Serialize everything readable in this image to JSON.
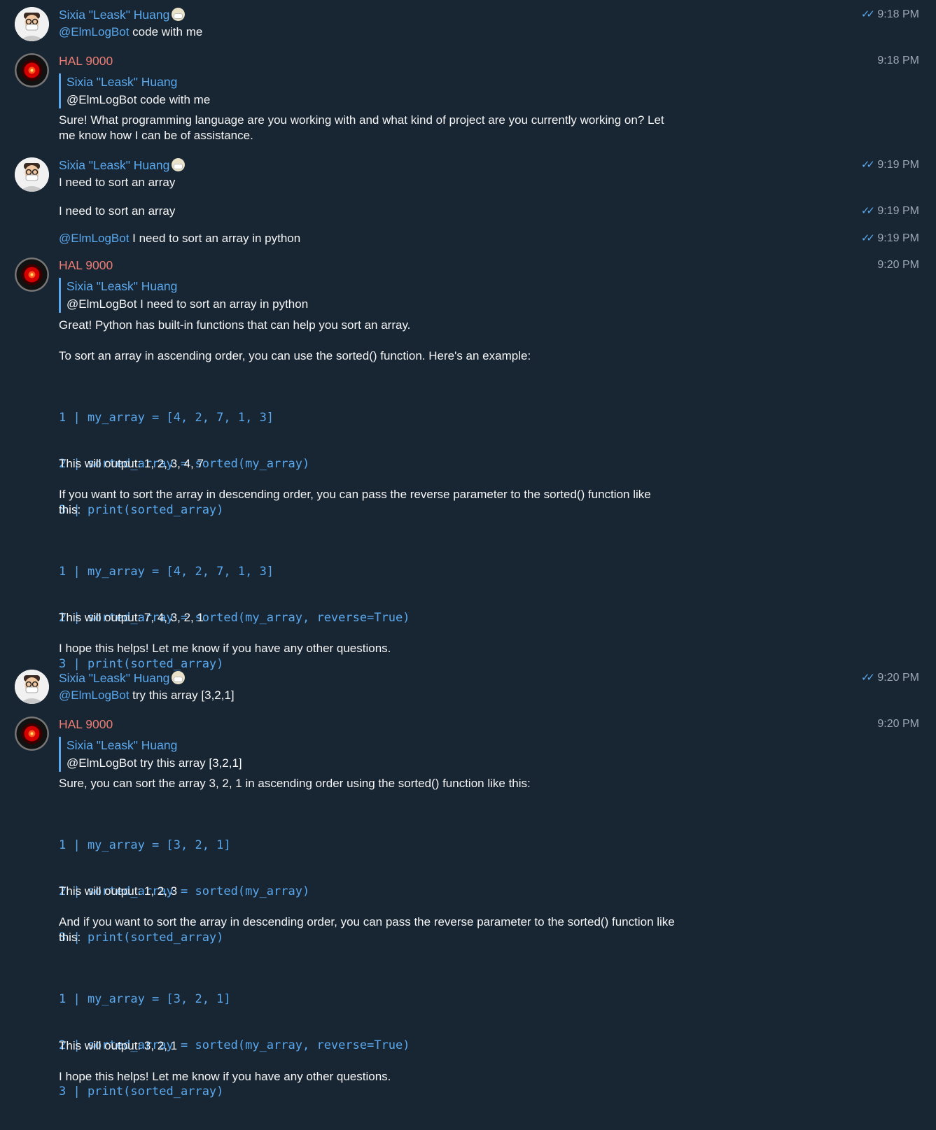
{
  "users": {
    "sixia": "Sixia \"Leask\" Huang",
    "hal": "HAL 9000",
    "bot_mention": "@ElmLogBot"
  },
  "messages": {
    "m1": {
      "text": "code with me",
      "time": "9:18 PM",
      "check": "✓✓"
    },
    "m2": {
      "time": "9:18 PM",
      "quote_text": "@ElmLogBot code with me",
      "text": "Sure! What programming language are you working with and what kind of project are you currently working on? Let me know how I can be of assistance."
    },
    "m3": {
      "text": "I need to sort an array",
      "time": "9:19 PM",
      "check": "✓✓"
    },
    "m4": {
      "text": "I need to sort an array",
      "time": "9:19 PM",
      "check": "✓✓"
    },
    "m5": {
      "text": "I need to sort an array in python",
      "time": "9:19 PM",
      "check": "✓✓"
    },
    "m6": {
      "time": "9:20 PM",
      "quote_text": "@ElmLogBot I need to sort an array in python",
      "p1": "Great! Python has built-in functions that can help you sort an array.",
      "p2": "To sort an array in ascending order, you can use the sorted() function. Here's an example:",
      "code1": [
        "1 | my_array = [4, 2, 7, 1, 3]",
        "2 | sorted_array = sorted(my_array)",
        "3 | print(sorted_array)"
      ],
      "p3": "This will output: 1, 2, 3, 4, 7",
      "p4": "If you want to sort the array in descending order, you can pass the reverse parameter to the sorted() function like this:",
      "code2": [
        "1 | my_array = [4, 2, 7, 1, 3]",
        "2 | sorted_array = sorted(my_array, reverse=True)",
        "3 | print(sorted_array)"
      ],
      "p5": "This will output: 7, 4, 3, 2, 1",
      "p6": "I hope this helps! Let me know if you have any other questions."
    },
    "m7": {
      "text": "try this array [3,2,1]",
      "time": "9:20 PM",
      "check": "✓✓"
    },
    "m8": {
      "time": "9:20 PM",
      "quote_text": "@ElmLogBot try this array [3,2,1]",
      "p1": "Sure, you can sort the array 3, 2, 1 in ascending order using the sorted() function like this:",
      "code1": [
        "1 | my_array = [3, 2, 1]",
        "2 | sorted_array = sorted(my_array)",
        "3 | print(sorted_array)"
      ],
      "p2": "This will output: 1, 2, 3",
      "p3": "And if you want to sort the array in descending order, you can pass the reverse parameter to the sorted() function like this:",
      "code2": [
        "1 | my_array = [3, 2, 1]",
        "2 | sorted_array = sorted(my_array, reverse=True)",
        "3 | print(sorted_array)"
      ],
      "p4": "This will output: 3, 2, 1",
      "p5": "I hope this helps! Let me know if you have any other questions."
    }
  }
}
